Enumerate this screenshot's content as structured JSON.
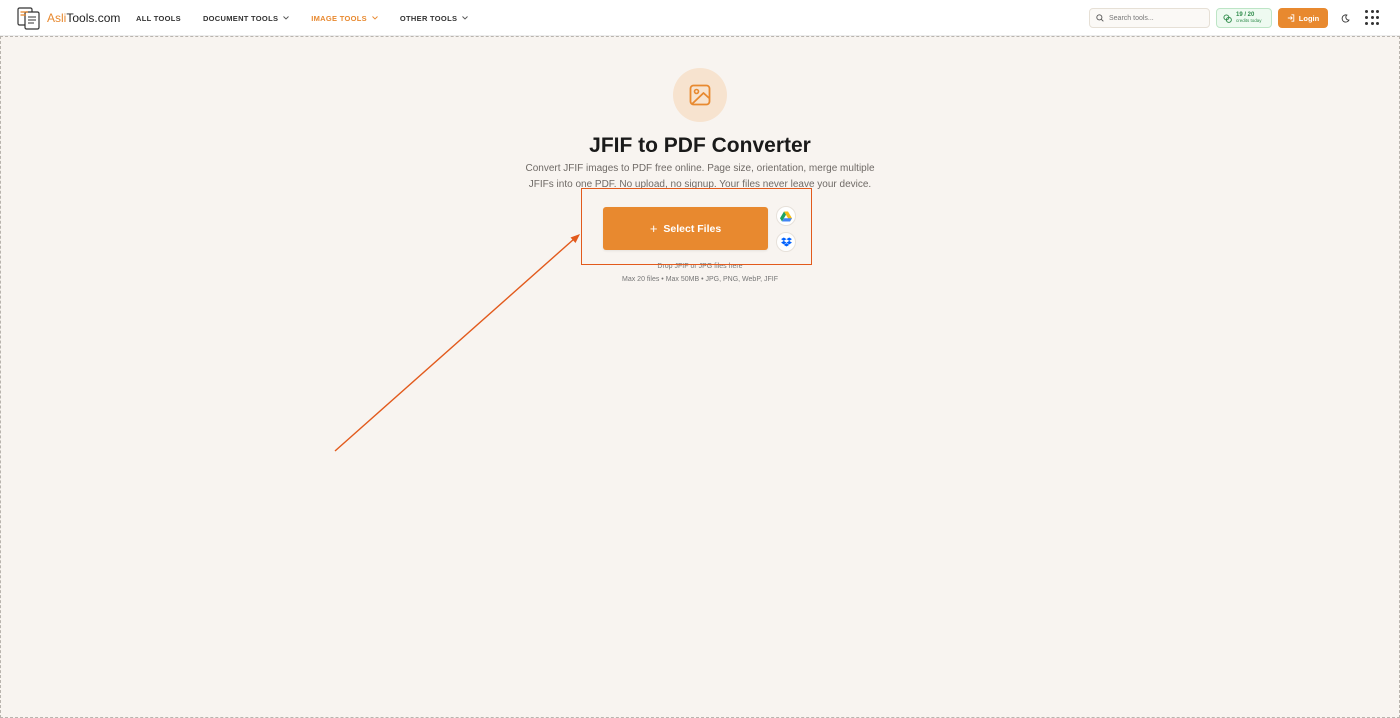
{
  "header": {
    "logo": {
      "brand_accent": "Asli",
      "brand_rest": "Tools.com"
    },
    "nav": [
      {
        "label": "ALL TOOLS",
        "has_dropdown": false,
        "active": false
      },
      {
        "label": "DOCUMENT TOOLS",
        "has_dropdown": true,
        "active": false
      },
      {
        "label": "IMAGE TOOLS",
        "has_dropdown": true,
        "active": true
      },
      {
        "label": "OTHER TOOLS",
        "has_dropdown": true,
        "active": false
      }
    ],
    "search": {
      "placeholder": "Search tools..."
    },
    "credits": {
      "count": "19 / 20",
      "caption": "credits today"
    },
    "login_label": "Login"
  },
  "main": {
    "title": "JFIF to PDF Converter",
    "subtitle": "Convert JFIF images to PDF free online. Page size, orientation, merge multiple JFIFs into one PDF. No upload, no signup. Your files never leave your device.",
    "select_button": {
      "plus": "+",
      "label": "Select Files"
    },
    "drop_hint": "Drop JFIF or JPG files here",
    "limits": "Max 20 files • Max 50MB • JPG, PNG, WebP, JFIF"
  },
  "icons": {
    "logo": "document-stack-icon",
    "search": "search-icon",
    "credits": "coins-icon",
    "login": "login-icon",
    "theme": "moon-icon",
    "apps": "grid-menu-icon",
    "hero": "image-icon",
    "gdrive": "google-drive-icon",
    "dropbox": "dropbox-icon"
  },
  "colors": {
    "accent": "#e8892f",
    "page_background": "#f8f4f0",
    "annotation": "#e25a1c",
    "credits_green": "#2e8b4a"
  }
}
